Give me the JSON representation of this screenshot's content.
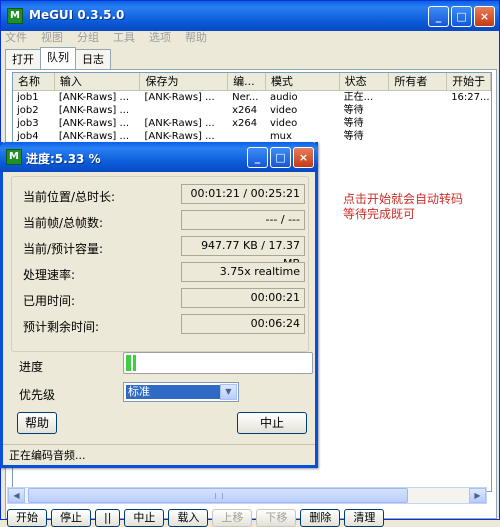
{
  "main_window": {
    "title": "MeGUI 0.3.5.0",
    "icon_text": "M",
    "title_buttons": [
      "minimize",
      "maximize",
      "close"
    ]
  },
  "menu": [
    "文件",
    "视图",
    "分组",
    "工具",
    "选项",
    "帮助"
  ],
  "tabs": [
    {
      "label": "打开",
      "active": false
    },
    {
      "label": "队列",
      "active": true
    },
    {
      "label": "日志",
      "active": false
    }
  ],
  "queue": {
    "columns": [
      "名称",
      "输入",
      "保存为",
      "编...",
      "模式",
      "状态",
      "所有者",
      "开始于"
    ],
    "rows": [
      [
        "job1",
        "[ANK-Raws] ...",
        "[ANK-Raws] ...",
        "Ner...",
        "audio",
        "正在...",
        "",
        "16:27..."
      ],
      [
        "job2",
        "[ANK-Raws] ...",
        "",
        "x264",
        "video",
        "等待",
        "",
        ""
      ],
      [
        "job3",
        "[ANK-Raws] ...",
        "[ANK-Raws] ...",
        "x264",
        "video",
        "等待",
        "",
        ""
      ],
      [
        "job4",
        "[ANK-Raws] ...",
        "[ANK-Raws] ...",
        "",
        "mux",
        "等待",
        "",
        ""
      ]
    ]
  },
  "bottom_buttons": [
    {
      "label": "开始",
      "enabled": true
    },
    {
      "label": "停止",
      "enabled": true
    },
    {
      "label": "||",
      "enabled": true
    },
    {
      "label": "中止",
      "enabled": true
    },
    {
      "label": "载入",
      "enabled": true
    },
    {
      "label": "上移",
      "enabled": false
    },
    {
      "label": "下移",
      "enabled": false
    },
    {
      "label": "删除",
      "enabled": true
    },
    {
      "label": "清理",
      "enabled": true
    }
  ],
  "progress_dialog": {
    "title": "进度:5.33 %",
    "icon_text": "M",
    "fields": [
      {
        "label": "当前位置/总时长:",
        "value": "00:01:21 / 00:25:21"
      },
      {
        "label": "当前帧/总帧数:",
        "value": "--- / ---"
      },
      {
        "label": "当前/预计容量:",
        "value": "947.77 KB / 17.37 MB"
      },
      {
        "label": "处理速率:",
        "value": "3.75x realtime"
      },
      {
        "label": "已用时间:",
        "value": "00:00:21"
      },
      {
        "label": "预计剩余时间:",
        "value": "00:06:24"
      }
    ],
    "progress_label": "进度",
    "progress_fraction": 0.0533,
    "priority_label": "优先级",
    "priority_value": "标准",
    "help_button": "帮助",
    "abort_button": "中止",
    "status": "正在编码音频..."
  },
  "annotation": [
    "点击开始就会自动转码",
    "等待完成既可"
  ],
  "colors": {
    "titlebar_blue": "#0b5ad8",
    "progress_green": "#3bd23d",
    "annotation_red": "#c8302a",
    "selection_blue": "#316ac5"
  }
}
